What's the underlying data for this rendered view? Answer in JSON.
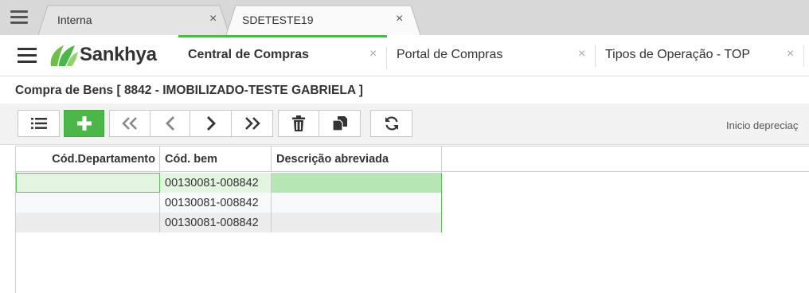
{
  "window_tabs": [
    {
      "label": "Interna",
      "close": "×"
    },
    {
      "label": "SDETESTE19",
      "close": "×"
    }
  ],
  "app": {
    "logo_text": "Sankhya",
    "tabs": [
      {
        "label": "Central de Compras",
        "close": "×"
      },
      {
        "label": "Portal de Compras",
        "close": "×"
      },
      {
        "label": "Tipos de Operação - TOP",
        "close": "×"
      }
    ]
  },
  "page": {
    "title": "Compra de Bens [ 8842 - IMOBILIZADO-TESTE GABRIELA ]"
  },
  "toolbar": {
    "right_label": "Inicio depreciaç",
    "buttons": [
      "list-icon",
      "plus-icon",
      "first-icon",
      "previous-icon",
      "next-icon",
      "last-icon",
      "trash-icon",
      "copy-icon",
      "refresh-icon"
    ]
  },
  "grid": {
    "columns": [
      "Cód.Departamento",
      "Cód. bem",
      "Descrição abreviada"
    ],
    "rows": [
      {
        "departamento": "",
        "cod_bem": "00130081-008842",
        "descricao": ""
      },
      {
        "departamento": "",
        "cod_bem": "00130081-008842",
        "descricao": ""
      },
      {
        "departamento": "",
        "cod_bem": "00130081-008842",
        "descricao": ""
      }
    ]
  },
  "colors": {
    "accent": "#4cb748",
    "selected_row": "#e3f5e1",
    "selected_cell": "#b6e6b3",
    "alt_row": "#ececec"
  }
}
